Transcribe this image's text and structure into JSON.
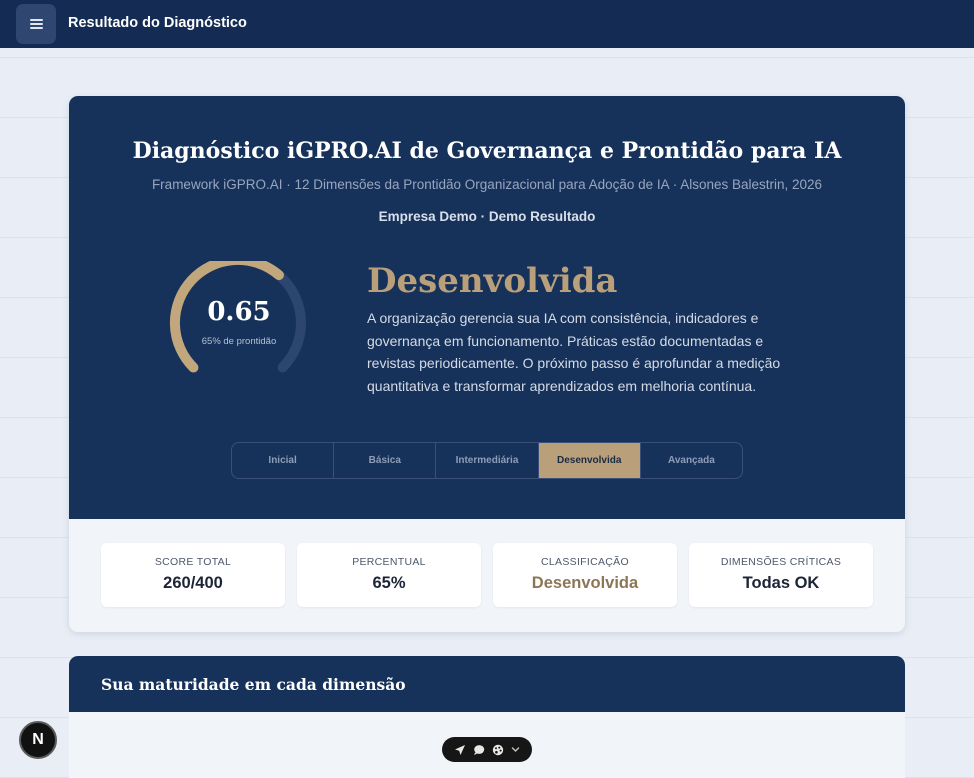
{
  "topbar": {
    "title": "Resultado do Diagnóstico",
    "menu_icon": "hamburger-menu-icon"
  },
  "hero": {
    "title": "Diagnóstico iGPRO.AI de Governança e Prontidão para IA",
    "subtitle": "Framework iGPRO.AI · 12 Dimensões da Prontidão Organizacional para Adoção de IA · Alsones Balestrin, 2026",
    "company": "Empresa Demo · Demo Resultado",
    "gauge": {
      "value": "0.65",
      "caption": "65% de prontidão",
      "fraction": 0.65,
      "fill_color": "#c2a67c",
      "track_color": "#2d4670"
    },
    "level": {
      "name": "Desenvolvida",
      "description": "A organização gerencia sua IA com consistência, indicadores e governança em funcionamento. Práticas estão documentadas e revistas periodicamente. O próximo passo é aprofundar a medição quantitativa e transformar aprendizados em melhoria contínua."
    },
    "steps": [
      "Inicial",
      "Básica",
      "Intermediária",
      "Desenvolvida",
      "Avançada"
    ],
    "active_step": "Desenvolvida"
  },
  "stats": [
    {
      "label": "SCORE TOTAL",
      "value": "260/400"
    },
    {
      "label": "PERCENTUAL",
      "value": "65%"
    },
    {
      "label": "CLASSIFICAÇÃO",
      "value": "Desenvolvida"
    },
    {
      "label": "DIMENSÕES CRÍTICAS",
      "value": "Todas OK"
    }
  ],
  "section": {
    "title": "Sua maturidade em cada dimensão"
  },
  "overlay": {
    "badge_letter": "N",
    "toolbar_icons": [
      "navigate-arrow-icon",
      "chat-bubble-icon",
      "palette-icon",
      "chevron-down-icon"
    ]
  },
  "colors": {
    "navy": "#17325a",
    "gold": "#b9a07a",
    "background": "#e9eef6"
  }
}
